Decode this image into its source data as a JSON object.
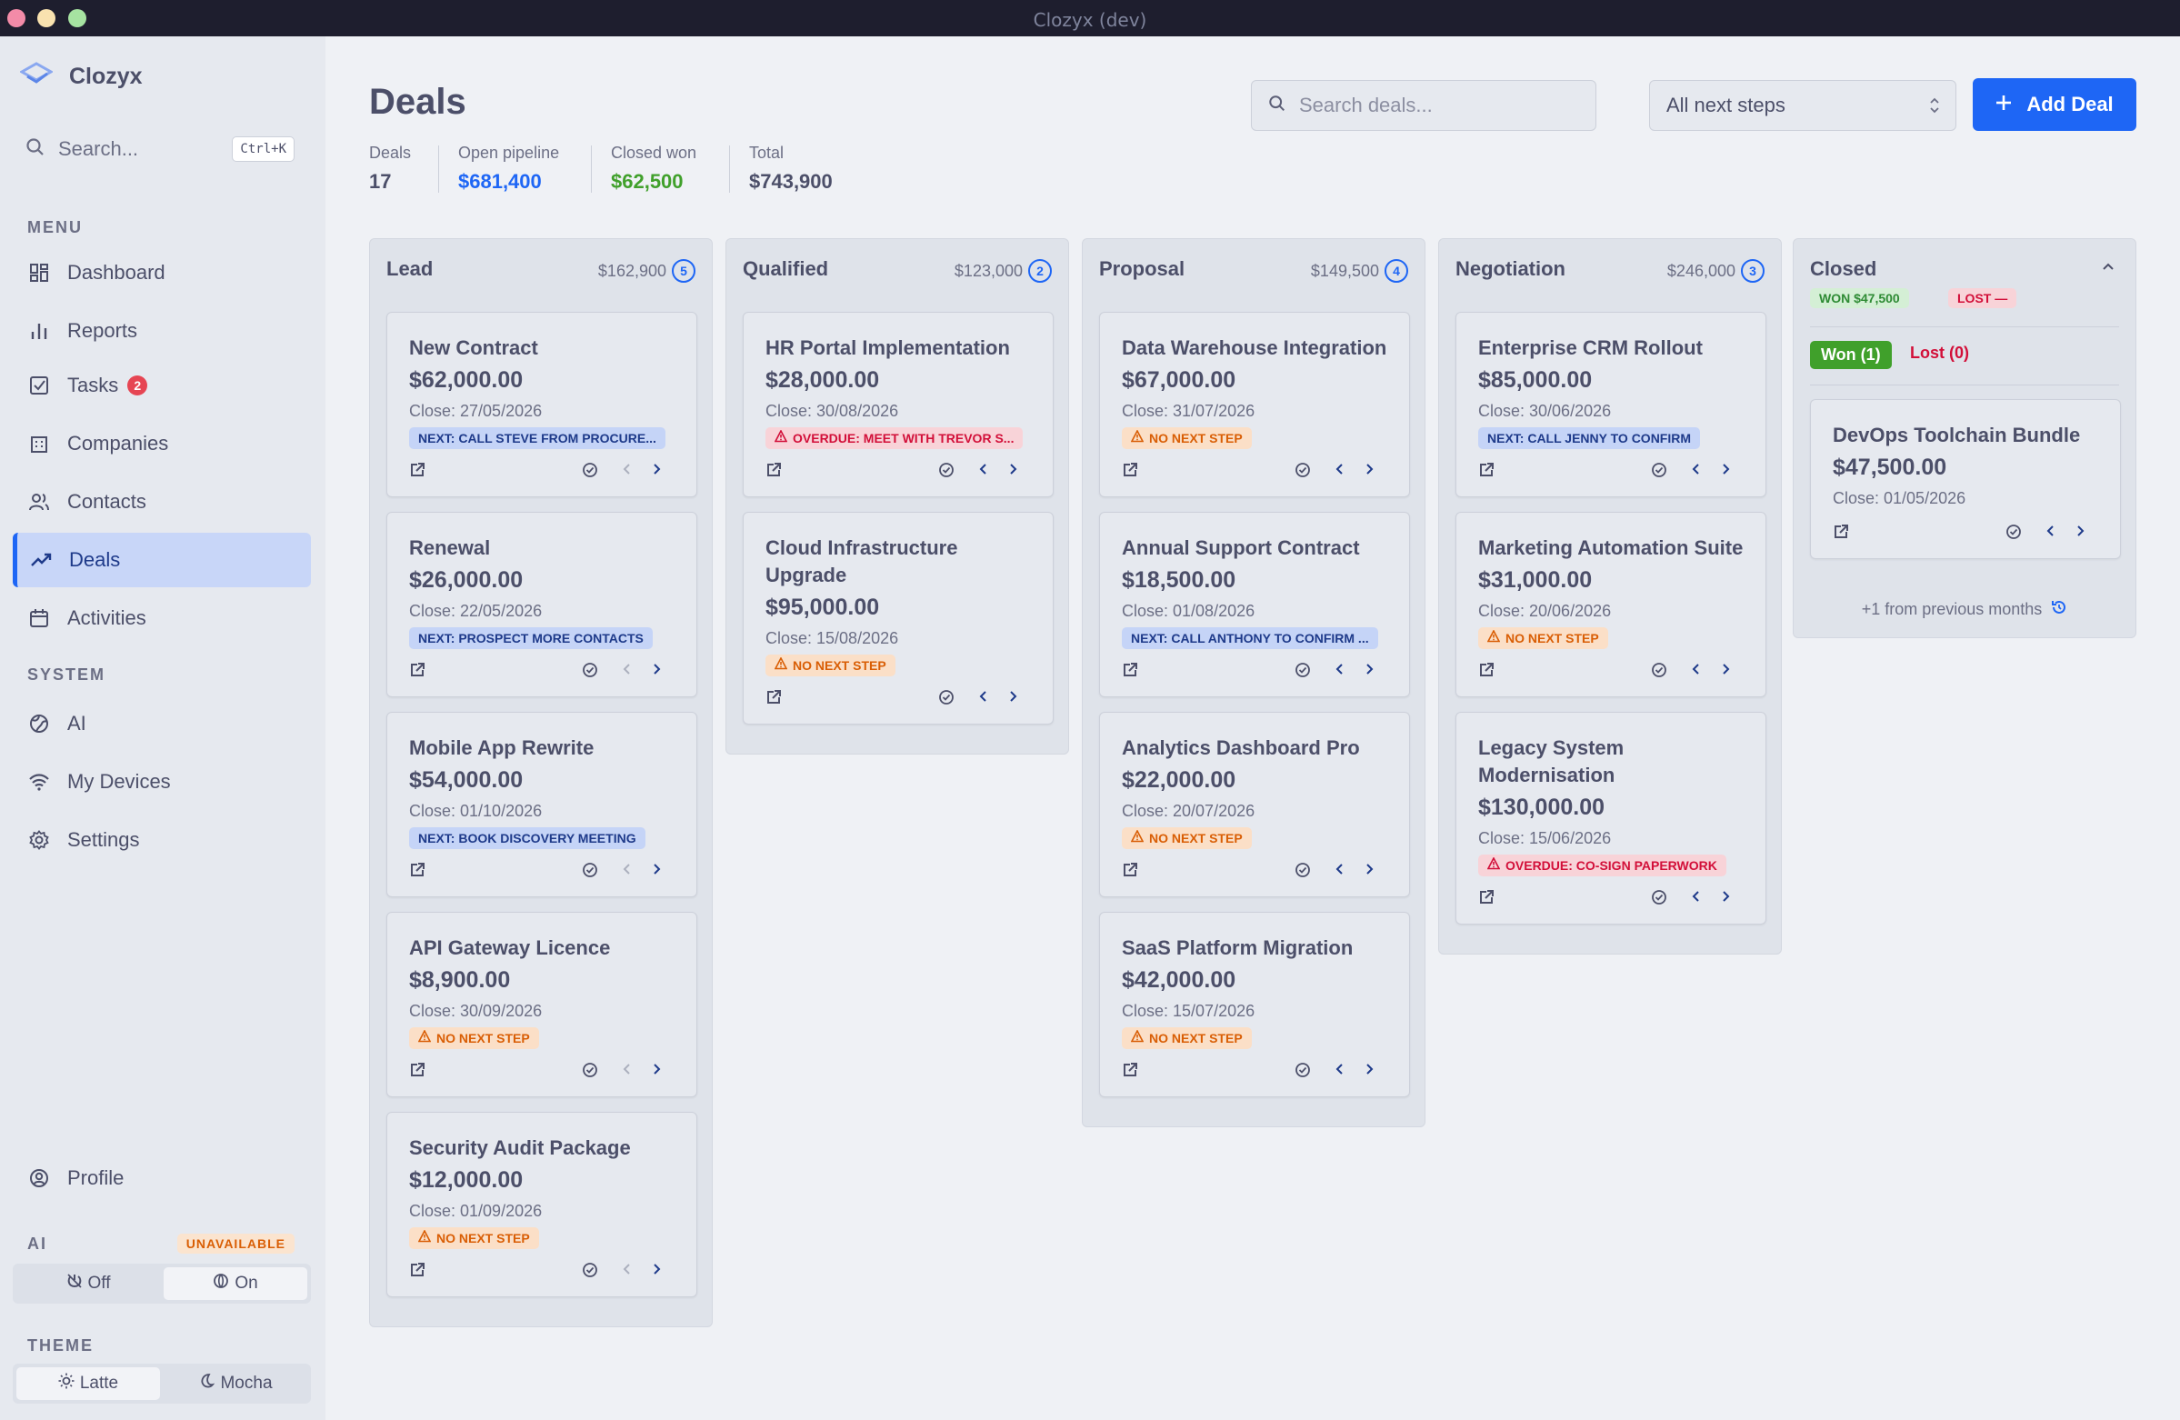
{
  "window": {
    "title": "Clozyx (dev)"
  },
  "sidebar": {
    "brand": "Clozyx",
    "search_placeholder": "Search...",
    "search_shortcut": "Ctrl+K",
    "menu_label": "MENU",
    "system_label": "SYSTEM",
    "menu_items": [
      {
        "label": "Dashboard",
        "icon": "dashboard-icon"
      },
      {
        "label": "Reports",
        "icon": "bar-chart-icon"
      },
      {
        "label": "Tasks",
        "icon": "checkbox-icon",
        "badge": "2"
      },
      {
        "label": "Companies",
        "icon": "building-icon"
      },
      {
        "label": "Contacts",
        "icon": "users-icon"
      },
      {
        "label": "Deals",
        "icon": "trending-up-icon",
        "active": true
      },
      {
        "label": "Activities",
        "icon": "calendar-icon"
      }
    ],
    "system_items": [
      {
        "label": "AI",
        "icon": "globe-icon"
      },
      {
        "label": "My Devices",
        "icon": "wifi-icon"
      },
      {
        "label": "Settings",
        "icon": "gear-icon"
      }
    ],
    "profile": "Profile",
    "ai": {
      "label": "AI",
      "status": "UNAVAILABLE",
      "off": "Off",
      "on": "On"
    },
    "theme": {
      "label": "THEME",
      "latte": "Latte",
      "mocha": "Mocha"
    }
  },
  "header": {
    "title": "Deals",
    "search_placeholder": "Search deals...",
    "filter_value": "All next steps",
    "add_label": "Add Deal",
    "stats": [
      {
        "label": "Deals",
        "value": "17",
        "color": "#4c4f69"
      },
      {
        "label": "Open pipeline",
        "value": "$681,400",
        "color": "#1e66f5"
      },
      {
        "label": "Closed won",
        "value": "$62,500",
        "color": "#40a02b"
      },
      {
        "label": "Total",
        "value": "$743,900",
        "color": "#4c4f69"
      }
    ]
  },
  "columns": [
    {
      "name": "Lead",
      "total": "$162,900",
      "count": "5",
      "cards": [
        {
          "title": "New Contract",
          "amount": "$62,000.00",
          "close": "Close: 27/05/2026",
          "tag": "NEXT: CALL STEVE FROM PROCURE...",
          "tag_type": "next"
        },
        {
          "title": "Renewal",
          "amount": "$26,000.00",
          "close": "Close: 22/05/2026",
          "tag": "NEXT: PROSPECT MORE CONTACTS",
          "tag_type": "next"
        },
        {
          "title": "Mobile App Rewrite",
          "amount": "$54,000.00",
          "close": "Close: 01/10/2026",
          "tag": "NEXT: BOOK DISCOVERY MEETING",
          "tag_type": "next"
        },
        {
          "title": "API Gateway Licence",
          "amount": "$8,900.00",
          "close": "Close: 30/09/2026",
          "tag": "NO NEXT STEP",
          "tag_type": "warn"
        },
        {
          "title": "Security Audit Package",
          "amount": "$12,000.00",
          "close": "Close: 01/09/2026",
          "tag": "NO NEXT STEP",
          "tag_type": "warn"
        }
      ]
    },
    {
      "name": "Qualified",
      "total": "$123,000",
      "count": "2",
      "cards": [
        {
          "title": "HR Portal Implementation",
          "amount": "$28,000.00",
          "close": "Close: 30/08/2026",
          "tag": "OVERDUE: MEET WITH TREVOR S...",
          "tag_type": "over"
        },
        {
          "title": "Cloud Infrastructure Upgrade",
          "amount": "$95,000.00",
          "close": "Close: 15/08/2026",
          "tag": "NO NEXT STEP",
          "tag_type": "warn"
        }
      ]
    },
    {
      "name": "Proposal",
      "total": "$149,500",
      "count": "4",
      "cards": [
        {
          "title": "Data Warehouse Integration",
          "amount": "$67,000.00",
          "close": "Close: 31/07/2026",
          "tag": "NO NEXT STEP",
          "tag_type": "warn"
        },
        {
          "title": "Annual Support Contract",
          "amount": "$18,500.00",
          "close": "Close: 01/08/2026",
          "tag": "NEXT: CALL ANTHONY TO CONFIRM ...",
          "tag_type": "next"
        },
        {
          "title": "Analytics Dashboard Pro",
          "amount": "$22,000.00",
          "close": "Close: 20/07/2026",
          "tag": "NO NEXT STEP",
          "tag_type": "warn"
        },
        {
          "title": "SaaS Platform Migration",
          "amount": "$42,000.00",
          "close": "Close: 15/07/2026",
          "tag": "NO NEXT STEP",
          "tag_type": "warn"
        }
      ]
    },
    {
      "name": "Negotiation",
      "total": "$246,000",
      "count": "3",
      "cards": [
        {
          "title": "Enterprise CRM Rollout",
          "amount": "$85,000.00",
          "close": "Close: 30/06/2026",
          "tag": "NEXT: CALL JENNY TO CONFIRM",
          "tag_type": "next"
        },
        {
          "title": "Marketing Automation Suite",
          "amount": "$31,000.00",
          "close": "Close: 20/06/2026",
          "tag": "NO NEXT STEP",
          "tag_type": "warn"
        },
        {
          "title": "Legacy System Modernisation",
          "amount": "$130,000.00",
          "close": "Close: 15/06/2026",
          "tag": "OVERDUE: CO-SIGN PAPERWORK",
          "tag_type": "over"
        }
      ]
    }
  ],
  "closed": {
    "name": "Closed",
    "won_badge": "WON $47,500",
    "lost_badge": "LOST —",
    "won_tab": "Won (1)",
    "lost_tab": "Lost (0)",
    "card": {
      "title": "DevOps Toolchain Bundle",
      "amount": "$47,500.00",
      "close": "Close: 01/05/2026"
    },
    "more": "+1 from previous months"
  }
}
